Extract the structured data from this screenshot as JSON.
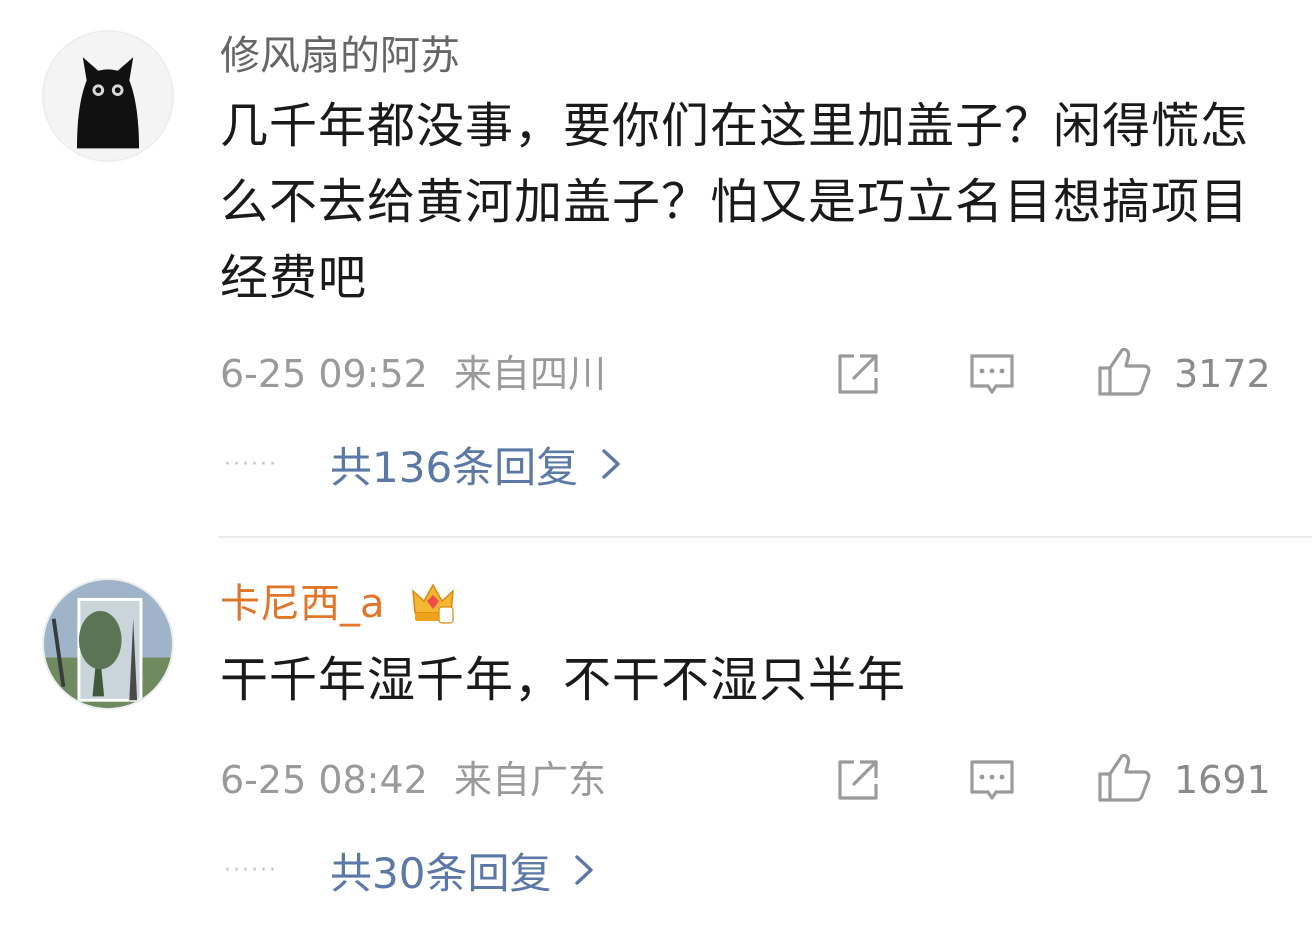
{
  "comments": [
    {
      "username": "修风扇的阿苏",
      "content": "几千年都没事，要你们在这里加盖子？闲得慌怎么不去给黄河加盖子？怕又是巧立名目想搞项目经费吧",
      "timestamp": "6-25 09:52",
      "location": "来自四川",
      "likes": "3172",
      "replies": "共136条回复"
    },
    {
      "username": "卡尼西_a",
      "content": "干千年湿千年，不干不湿只半年",
      "timestamp": "6-25 08:42",
      "location": "来自广东",
      "likes": "1691",
      "replies": "共30条回复"
    }
  ],
  "icons": {
    "share": "share-icon",
    "comment": "comment-icon",
    "like": "thumbs-up-icon",
    "more": "chevron-right-icon",
    "vip": "crown-badge-icon"
  },
  "colors": {
    "username": "#666666",
    "vip_username": "#e0762a",
    "content": "#1a1a1a",
    "meta": "#9a9a9a",
    "link": "#5b78a6",
    "divider": "#ececec"
  }
}
